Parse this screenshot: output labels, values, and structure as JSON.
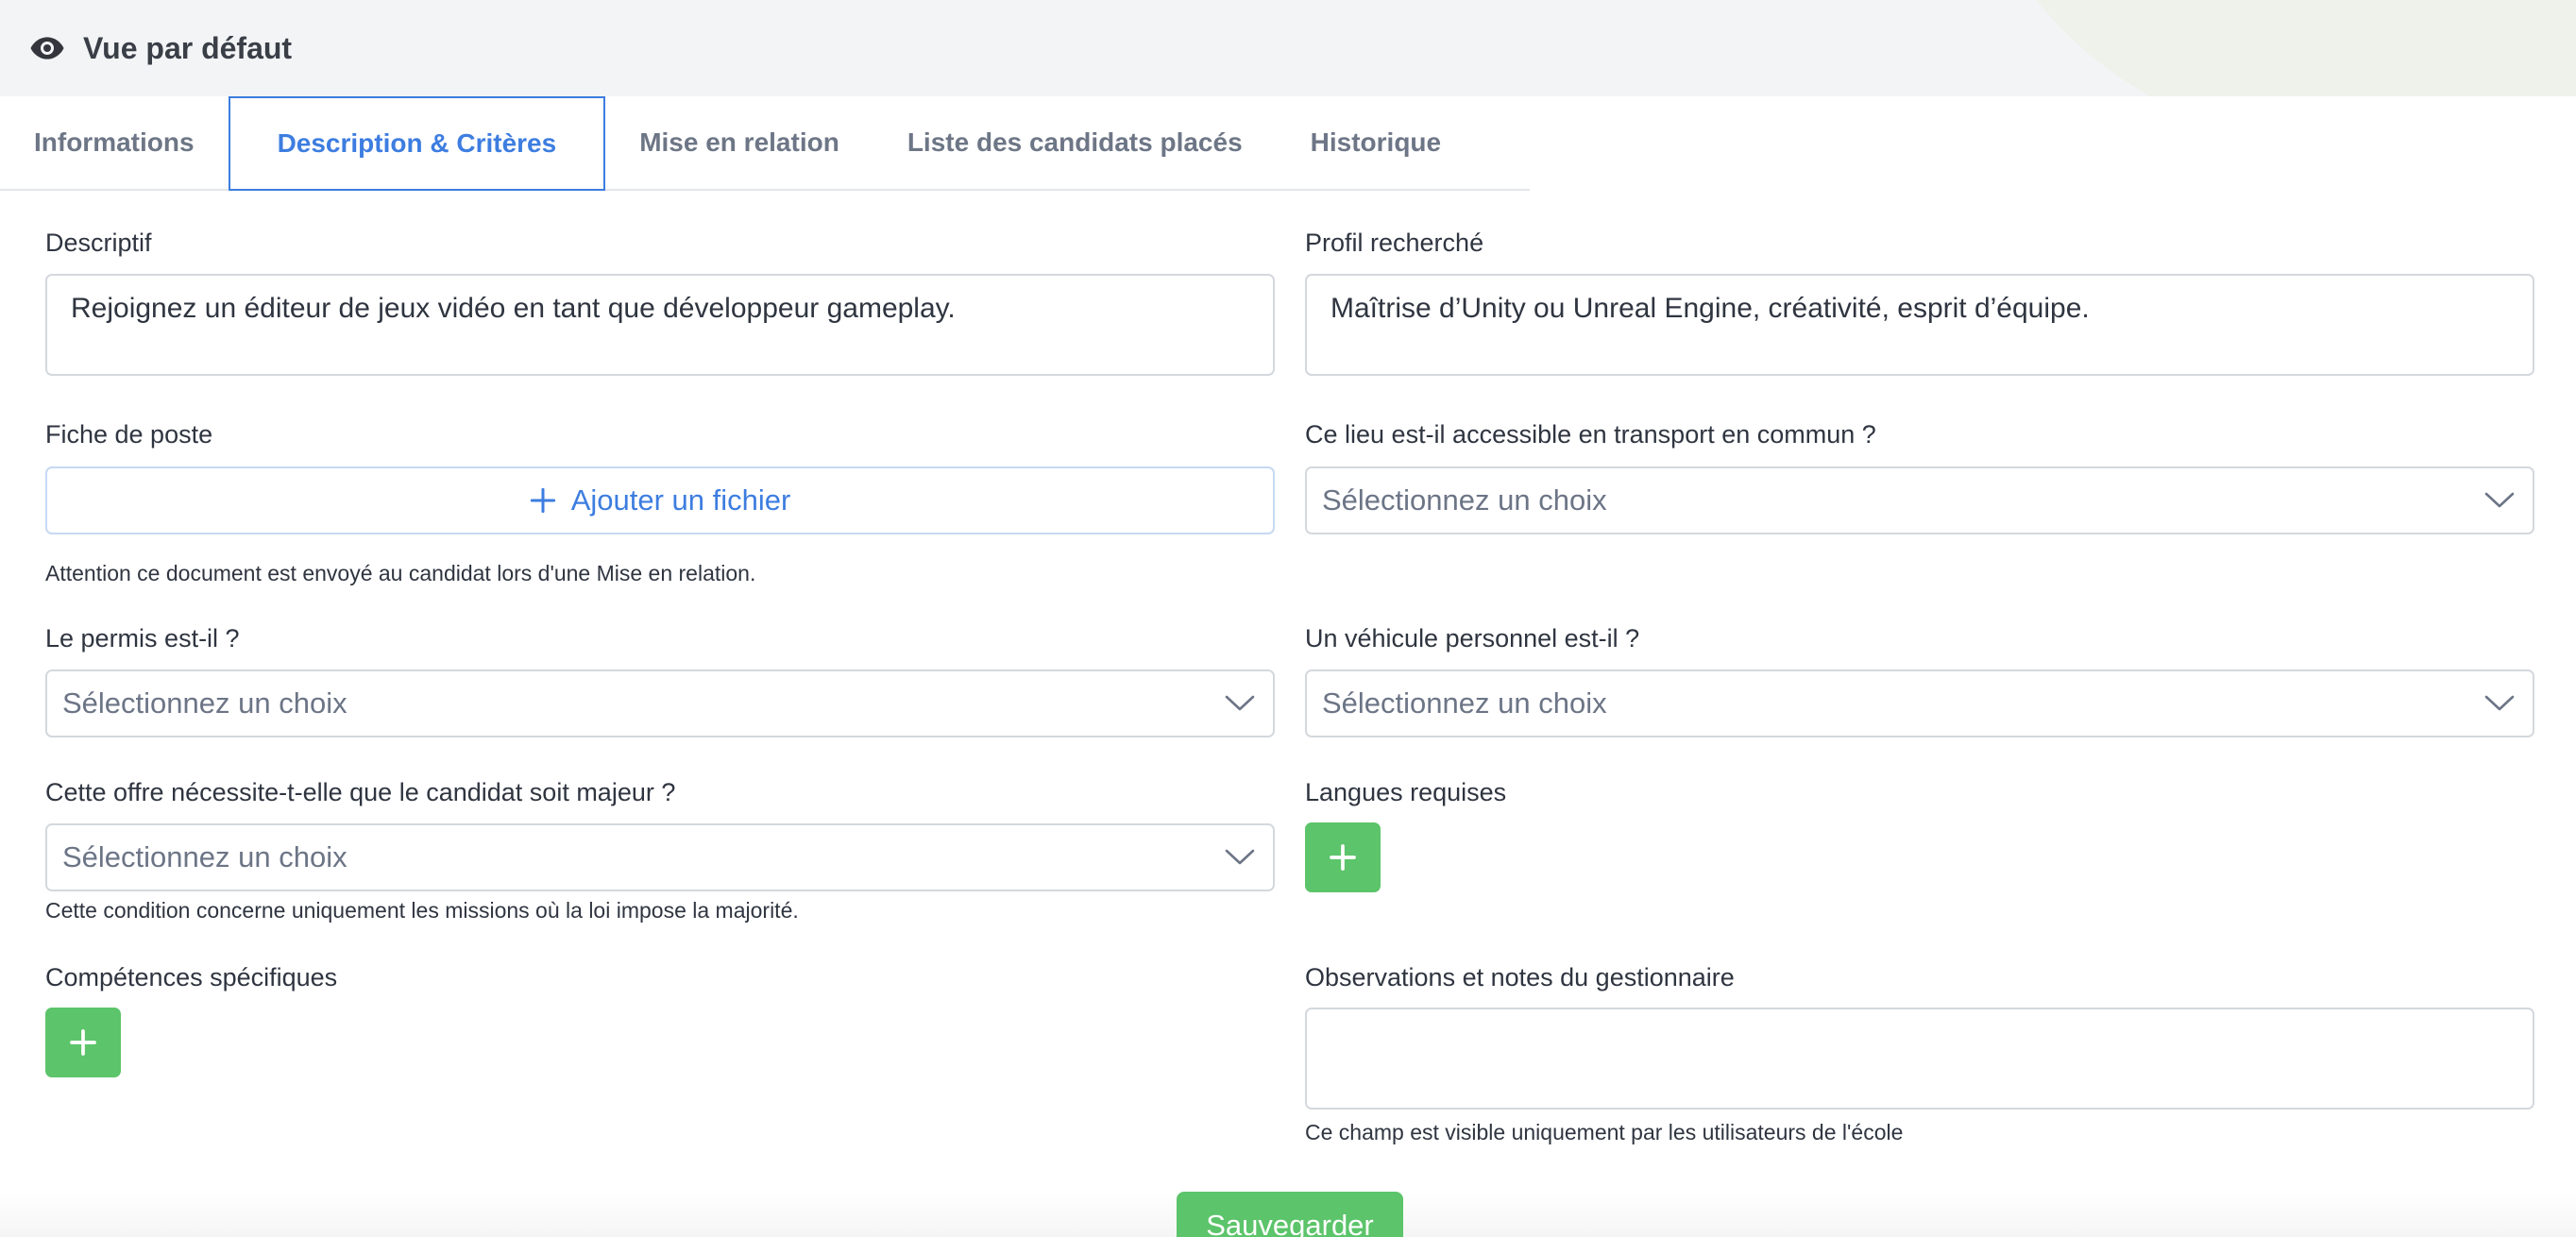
{
  "header": {
    "title": "Vue par défaut",
    "icon": "eye-icon"
  },
  "tabs": [
    {
      "label": "Informations",
      "active": false
    },
    {
      "label": "Description & Critères",
      "active": true
    },
    {
      "label": "Mise en relation",
      "active": false
    },
    {
      "label": "Liste des candidats placés",
      "active": false
    },
    {
      "label": "Historique",
      "active": false
    }
  ],
  "form": {
    "descriptif": {
      "label": "Descriptif",
      "value": "Rejoignez un éditeur de jeux vidéo en tant que développeur gameplay."
    },
    "profil": {
      "label": "Profil recherché",
      "value": "Maîtrise d’Unity ou Unreal Engine, créativité, esprit d’équipe."
    },
    "fiche": {
      "label": "Fiche de poste",
      "button": "Ajouter un fichier",
      "help": "Attention ce document est envoyé au candidat lors d'une Mise en relation."
    },
    "transport": {
      "label": "Ce lieu est-il accessible en transport en commun ?",
      "placeholder": "Sélectionnez un choix"
    },
    "permis": {
      "label": "Le permis est-il ?",
      "placeholder": "Sélectionnez un choix"
    },
    "vehicule": {
      "label": "Un véhicule personnel est-il ?",
      "placeholder": "Sélectionnez un choix"
    },
    "majeur": {
      "label": "Cette offre nécessite-t-elle que le candidat soit majeur ?",
      "placeholder": "Sélectionnez un choix",
      "help": "Cette condition concerne uniquement les missions où la loi impose la majorité."
    },
    "langues": {
      "label": "Langues requises"
    },
    "competences": {
      "label": "Compétences spécifiques"
    },
    "observations": {
      "label": "Observations et notes du gestionnaire",
      "value": "",
      "help": "Ce champ est visible uniquement par les utilisateurs de l'école"
    }
  },
  "footer": {
    "save_label": "Sauvegarder"
  },
  "colors": {
    "accent_blue": "#3d7de0",
    "add_green": "#5cc46a",
    "border": "#d4d8de"
  }
}
